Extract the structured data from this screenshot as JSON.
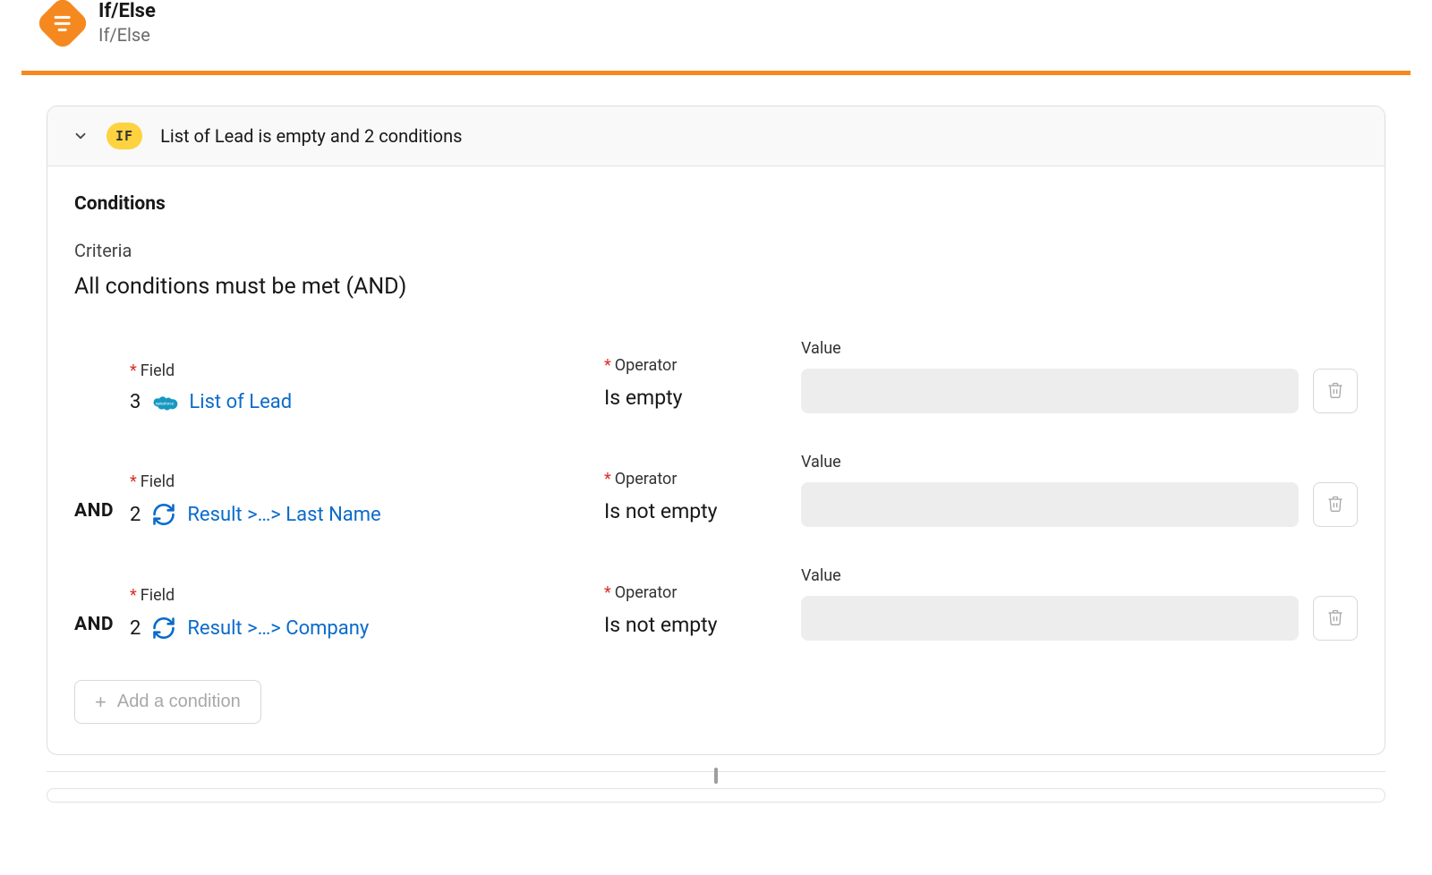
{
  "step": {
    "title": "If/Else",
    "subtitle": "If/Else"
  },
  "branch": {
    "badge": "IF",
    "summary": "List of Lead is empty and 2 conditions",
    "conditions_heading": "Conditions",
    "criteria_label": "Criteria",
    "criteria_value": "All conditions must be met (AND)",
    "labels": {
      "field": "Field",
      "operator": "Operator",
      "value": "Value",
      "logic_and": "AND"
    },
    "rows": [
      {
        "logic": "",
        "step_num": "3",
        "icon": "salesforce",
        "field_text": "List of Lead",
        "operator": "Is empty",
        "value": ""
      },
      {
        "logic": "AND",
        "step_num": "2",
        "icon": "loop",
        "field_text": "Result >…> Last Name",
        "operator": "Is not empty",
        "value": ""
      },
      {
        "logic": "AND",
        "step_num": "2",
        "icon": "loop",
        "field_text": "Result >…> Company",
        "operator": "Is not empty",
        "value": ""
      }
    ],
    "add_button": "Add a condition"
  }
}
